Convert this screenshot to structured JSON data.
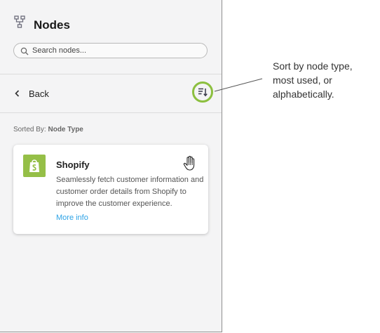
{
  "header": {
    "title": "Nodes",
    "icon": "node-tree-icon"
  },
  "search": {
    "placeholder": "Search nodes...",
    "value": ""
  },
  "toolbar": {
    "back_label": "Back",
    "sort_icon": "sort-icon"
  },
  "sort": {
    "prefix": "Sorted By:",
    "value": "Node Type"
  },
  "card": {
    "title": "Shopify",
    "description": "Seamlessly fetch customer information and customer order details from Shopify to improve the customer experience.",
    "link": "More info",
    "logo": "shopify-icon"
  },
  "annotation": {
    "text": "Sort by node type, most used, or alphabetically."
  },
  "colors": {
    "highlight": "#8cbf3f",
    "shopify_green": "#95bf47",
    "link": "#2ea3e6"
  }
}
